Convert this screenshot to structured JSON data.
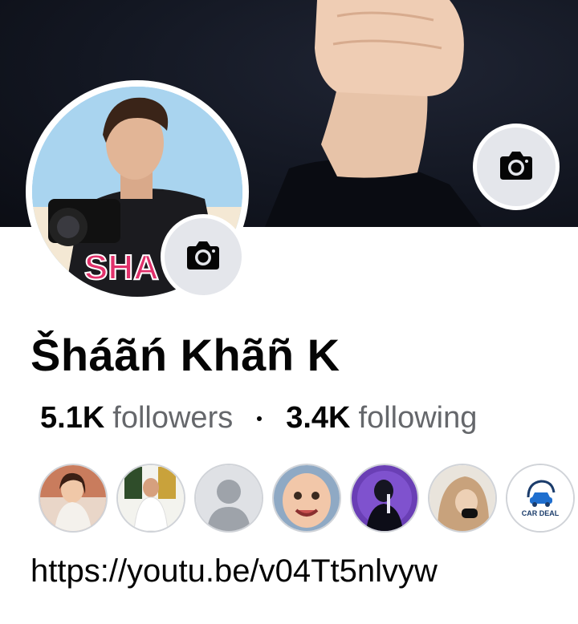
{
  "profile": {
    "name": "Šháãń Khãñ K",
    "avatar_overlay_text": "SHA"
  },
  "stats": {
    "followers_count": "5.1K",
    "followers_label": "followers",
    "following_count": "3.4K",
    "following_label": "following"
  },
  "featured_friends": [
    {
      "name": "friend-1"
    },
    {
      "name": "friend-2"
    },
    {
      "name": "friend-3-default"
    },
    {
      "name": "friend-4"
    },
    {
      "name": "friend-5"
    },
    {
      "name": "friend-6"
    },
    {
      "name": "friend-7-car-deal",
      "logo_text": "CAR DEAL"
    }
  ],
  "bio": {
    "link": "https://youtu.be/v04Tt5nlvyw"
  },
  "icons": {
    "cover_camera": "camera-icon",
    "profile_camera": "camera-icon"
  },
  "colors": {
    "cover_bg": "#131722",
    "button_bg": "#e4e6eb",
    "secondary_text": "#65676b"
  }
}
